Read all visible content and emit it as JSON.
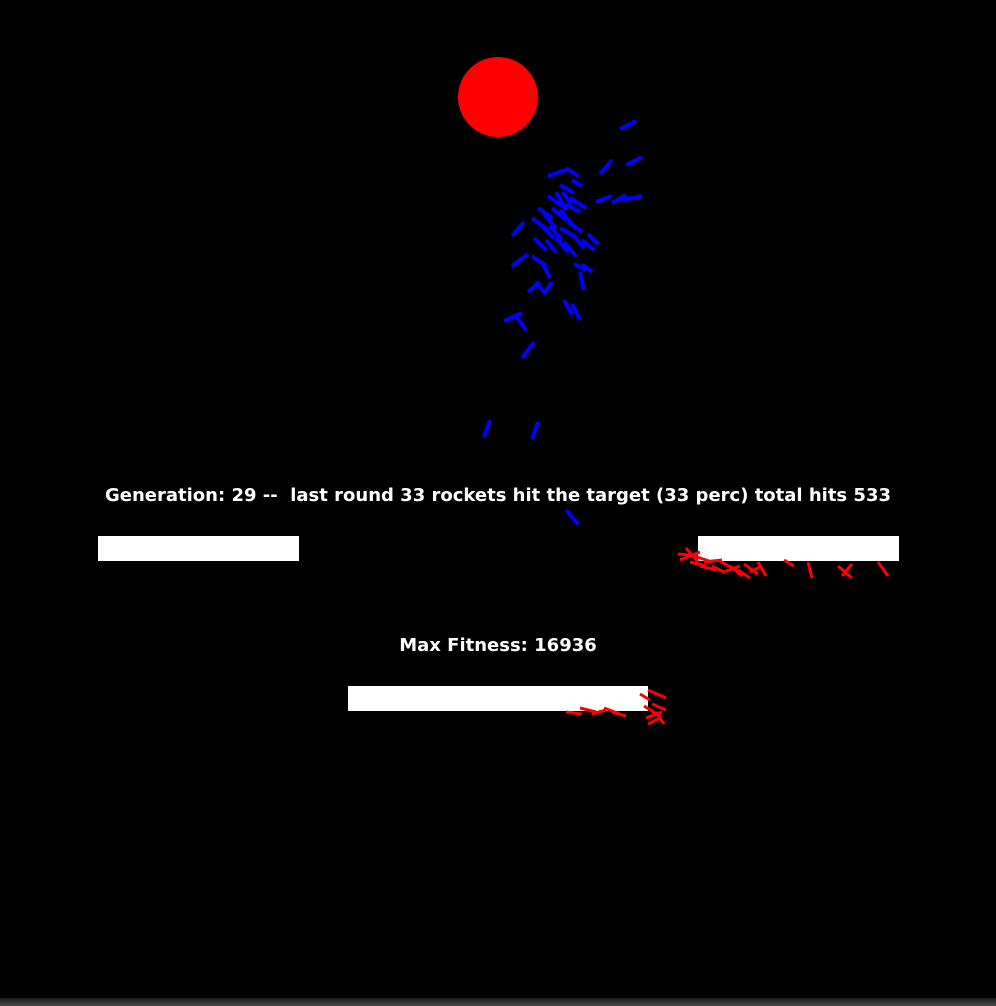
{
  "hud": {
    "generation_line": "Generation: 29 --  last round 33 rockets hit the target (33 perc) total hits 533",
    "fitness_line": "Max Fitness: 16936"
  },
  "scene": {
    "target_icon": "target-circle",
    "rocket_icon": "rocket-line",
    "obstacle_icon": "wall-block",
    "colors": {
      "background": "#000000",
      "target": "#ff0000",
      "flying_rocket": "#0000ff",
      "crashed_rocket": "#ff0000",
      "obstacle": "#ffffff",
      "text": "#ffffff"
    }
  }
}
